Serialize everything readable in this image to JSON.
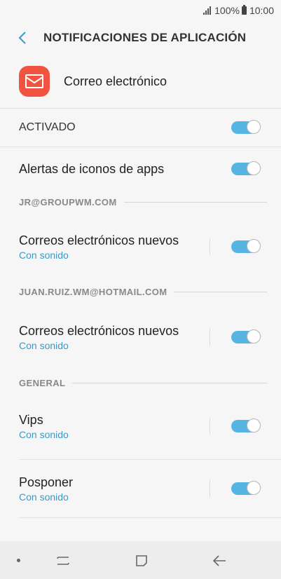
{
  "status_bar": {
    "battery": "100%",
    "time": "10:00"
  },
  "header": {
    "title": "NOTIFICACIONES DE APLICACIÓN"
  },
  "app": {
    "name": "Correo electrónico"
  },
  "master": {
    "label": "ACTIVADO",
    "enabled": true
  },
  "badge_row": {
    "title": "Alertas de iconos de apps",
    "enabled": true
  },
  "sections": [
    {
      "header": "JR@GROUPWM.COM",
      "items": [
        {
          "title": "Correos electrónicos nuevos",
          "subtitle": "Con sonido",
          "enabled": true
        }
      ]
    },
    {
      "header": "JUAN.RUIZ.WM@HOTMAIL.COM",
      "items": [
        {
          "title": "Correos electrónicos nuevos",
          "subtitle": "Con sonido",
          "enabled": true
        }
      ]
    },
    {
      "header": "GENERAL",
      "items": [
        {
          "title": "Vips",
          "subtitle": "Con sonido",
          "enabled": true
        },
        {
          "title": "Posponer",
          "subtitle": "Con sonido",
          "enabled": true
        }
      ]
    }
  ],
  "colors": {
    "accent": "#56b5e2",
    "subtitle": "#3a9ac8",
    "app_icon": "#f0533f"
  },
  "icons": {
    "back": "chevron-left-icon",
    "app": "mail-icon",
    "nav_recents": "recents-icon",
    "nav_home": "home-icon",
    "nav_back": "back-arrow-icon"
  }
}
